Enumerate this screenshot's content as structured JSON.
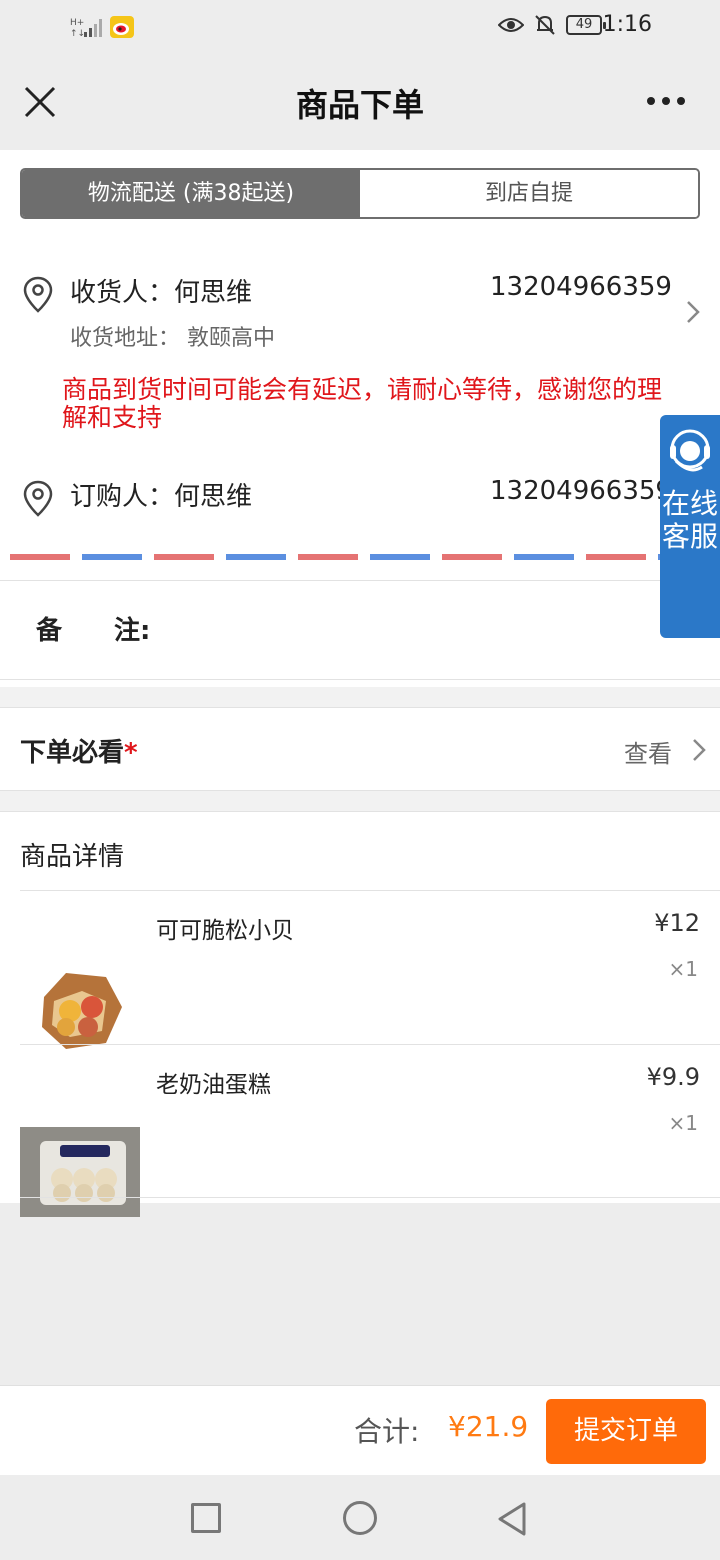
{
  "status_bar": {
    "time": "1:16",
    "battery": "49",
    "icons": [
      "signal-icon",
      "weibo-icon",
      "eye-icon",
      "mute-bell-icon",
      "battery-icon"
    ]
  },
  "nav": {
    "title": "商品下单",
    "close_icon": "close-icon",
    "more_icon": "more-icon"
  },
  "delivery_tabs": [
    {
      "label": "物流配送 (满38起送)",
      "active": true
    },
    {
      "label": "到店自提",
      "active": false
    }
  ],
  "receiver": {
    "label": "收货人：何思维",
    "phone": "13204966359",
    "address": "收货地址： 敦颐高中"
  },
  "notice": "商品到货时间可能会有延迟，请耐心等待，感谢您的理解和支持",
  "orderer": {
    "label": "订购人：何思维",
    "phone": "13204966359"
  },
  "remark": {
    "label_a": "备",
    "label_b": "注:"
  },
  "must_read": {
    "label": "下单必看",
    "star": "*",
    "link": "查看"
  },
  "details": {
    "title": "商品详情",
    "items": [
      {
        "name": "可可脆松小贝",
        "price": "¥12",
        "qty": "×1"
      },
      {
        "name": "老奶油蛋糕",
        "price": "¥9.9",
        "qty": "×1"
      }
    ]
  },
  "customer_service": {
    "label": "在线客服"
  },
  "footer": {
    "total_label": "合计:",
    "total_price": "¥21.9",
    "submit_label": "提交订单"
  },
  "colors": {
    "accent": "#ff6a0a",
    "price": "#ff7a12",
    "notice": "#e0161b",
    "cs_blue": "#2b78c8"
  }
}
